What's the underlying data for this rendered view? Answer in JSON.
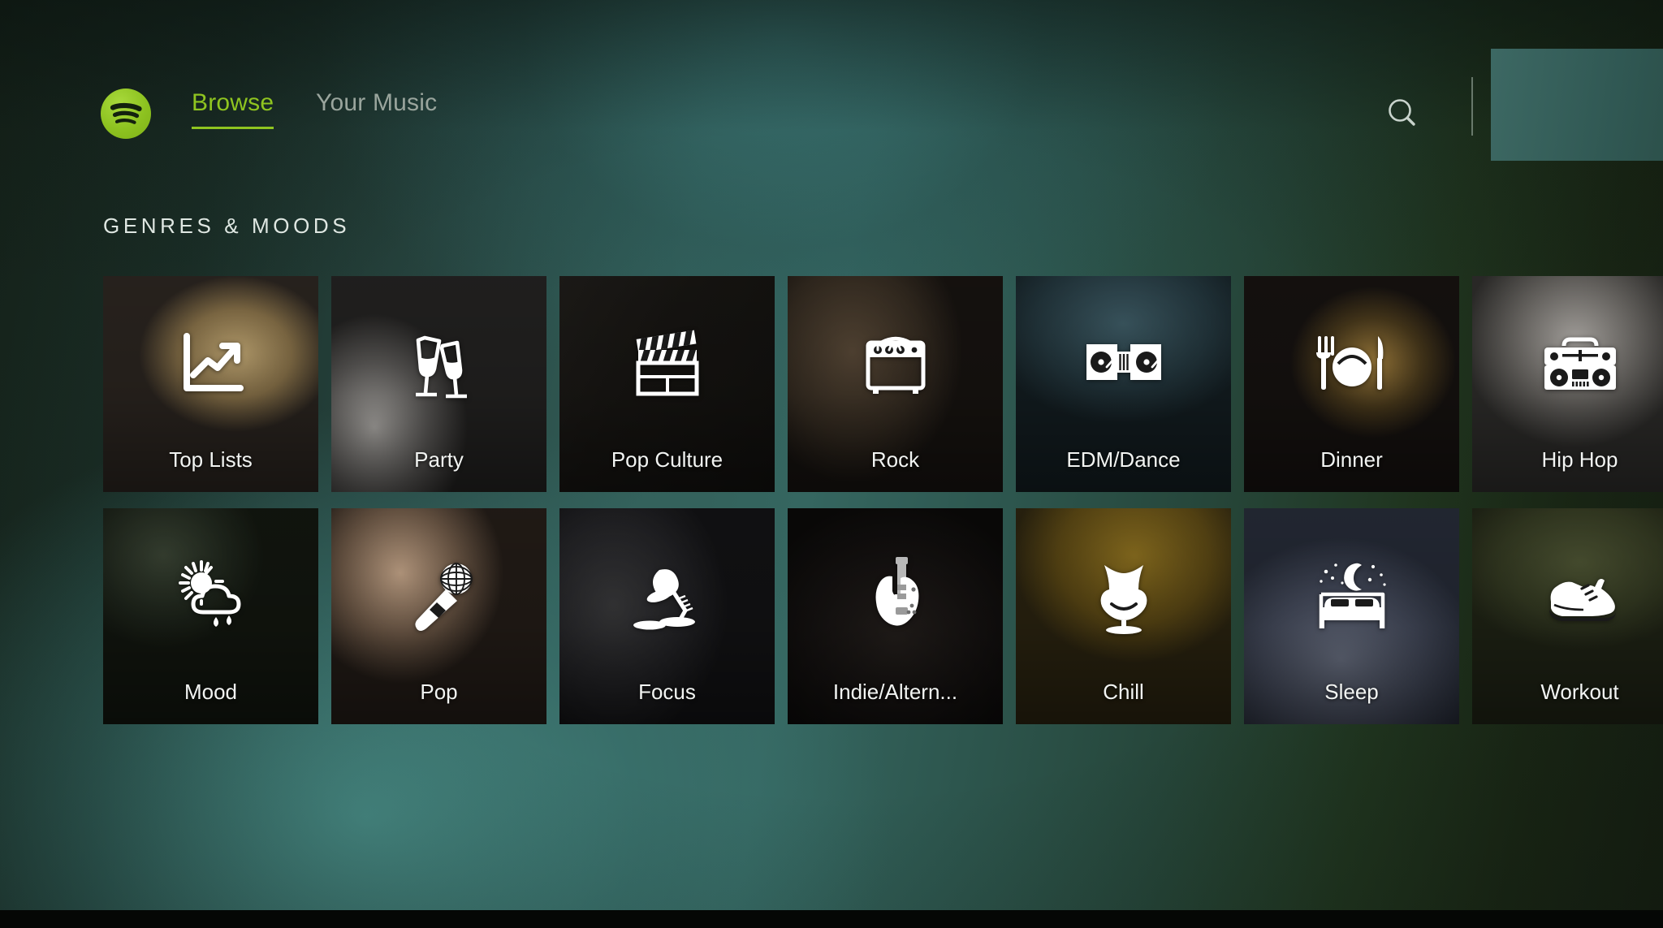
{
  "app": {
    "name": "Spotify",
    "accent_green": "#8fc420",
    "focus_border_color": "#ffffff",
    "tile_label_color": "#f2f4f2"
  },
  "header": {
    "logo_icon": "spotify-logo-icon",
    "nav": [
      {
        "label": "Browse",
        "active": true
      },
      {
        "label": "Your Music",
        "active": false
      }
    ],
    "search_icon": "search-icon",
    "account_panel_label": ""
  },
  "main": {
    "section_title": "GENRES & MOODS",
    "rows": [
      [
        {
          "label": "Top Lists",
          "icon": "trending-up-chart-icon",
          "art": "art-toplists",
          "focused": true
        },
        {
          "label": "Party",
          "icon": "champagne-glasses-icon",
          "art": "art-party",
          "focused": false
        },
        {
          "label": "Pop Culture",
          "icon": "clapperboard-icon",
          "art": "art-popculture",
          "focused": false
        },
        {
          "label": "Rock",
          "icon": "guitar-amp-icon",
          "art": "art-rock",
          "focused": false
        },
        {
          "label": "EDM/Dance",
          "icon": "dj-turntables-icon",
          "art": "art-edm",
          "focused": false
        },
        {
          "label": "Dinner",
          "icon": "plate-fork-knife-icon",
          "art": "art-dinner",
          "focused": false
        },
        {
          "label": "Hip Hop",
          "icon": "boombox-icon",
          "art": "art-hiphop",
          "focused": false
        }
      ],
      [
        {
          "label": "Mood",
          "icon": "sun-rain-cloud-icon",
          "art": "art-mood",
          "focused": false
        },
        {
          "label": "Pop",
          "icon": "microphone-icon",
          "art": "art-pop",
          "focused": false
        },
        {
          "label": "Focus",
          "icon": "desk-lamp-icon",
          "art": "art-focus",
          "focused": false
        },
        {
          "label": "Indie/Altern...",
          "icon": "electric-guitar-icon",
          "art": "art-indie",
          "focused": false
        },
        {
          "label": "Chill",
          "icon": "egg-chair-icon",
          "art": "art-chill",
          "focused": false
        },
        {
          "label": "Sleep",
          "icon": "bed-moon-stars-icon",
          "art": "art-sleep",
          "focused": false
        },
        {
          "label": "Workout",
          "icon": "running-shoe-icon",
          "art": "art-workout",
          "focused": false
        }
      ]
    ]
  }
}
